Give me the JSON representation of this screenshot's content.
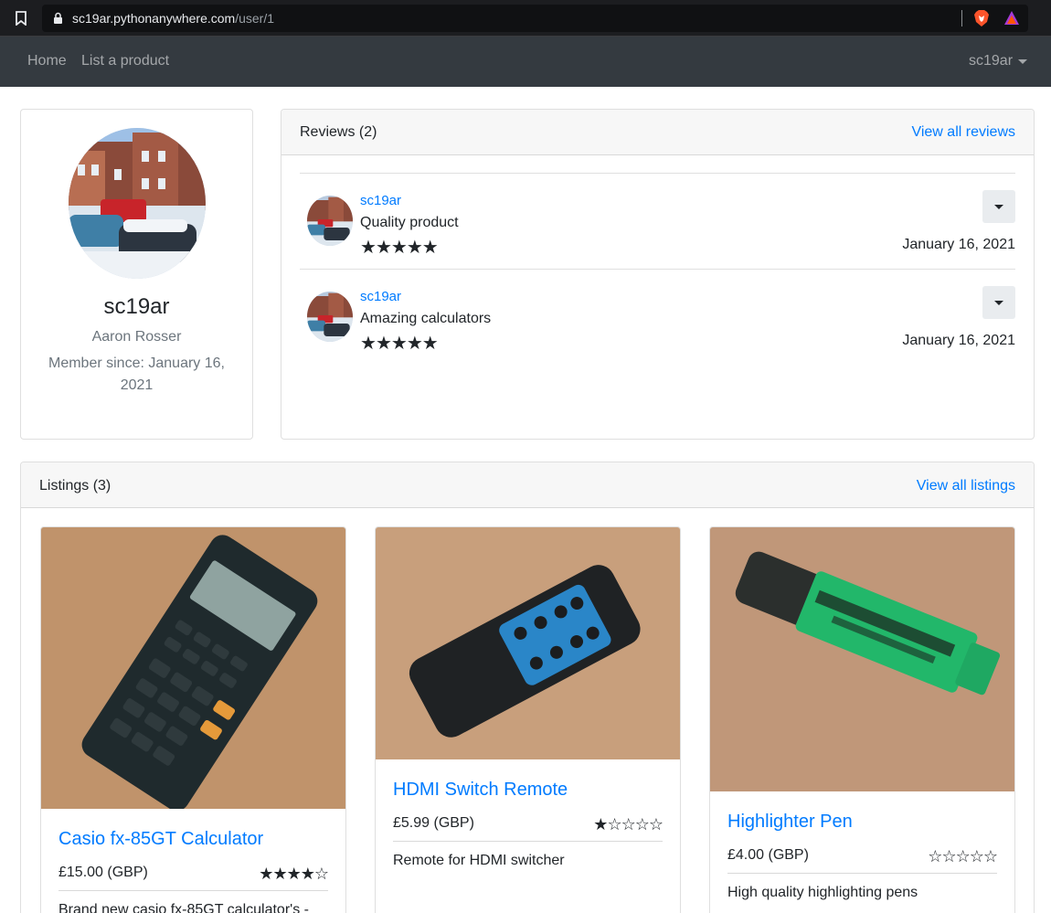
{
  "browser": {
    "url_host": "sc19ar.pythonanywhere.com",
    "url_path": "/user/1"
  },
  "navbar": {
    "home_label": "Home",
    "list_product_label": "List a product",
    "user_label": "sc19ar"
  },
  "profile": {
    "username": "sc19ar",
    "full_name": "Aaron Rosser",
    "member_since": "Member since: January 16, 2021"
  },
  "reviews": {
    "header_title": "Reviews (2)",
    "view_all_label": "View all reviews",
    "items": [
      {
        "author": "sc19ar",
        "text": "Quality product",
        "rating": 5,
        "date": "January 16, 2021"
      },
      {
        "author": "sc19ar",
        "text": "Amazing calculators",
        "rating": 5,
        "date": "January 16, 2021"
      }
    ]
  },
  "listings": {
    "header_title": "Listings (3)",
    "view_all_label": "View all listings",
    "items": [
      {
        "title": "Casio fx-85GT Calculator",
        "price": "£15.00 (GBP)",
        "rating": 4,
        "description": "Brand new casio fx-85GT calculator's -"
      },
      {
        "title": "HDMI Switch Remote",
        "price": "£5.99 (GBP)",
        "rating": 1,
        "description": "Remote for HDMI switcher"
      },
      {
        "title": "Highlighter Pen",
        "price": "£4.00 (GBP)",
        "rating": 0,
        "description": "High quality highlighting pens"
      }
    ]
  },
  "colors": {
    "navbar_bg": "#343a40",
    "link": "#007bff",
    "card_header_bg": "#f7f7f7"
  },
  "icons": [
    "bookmark-icon",
    "lock-icon",
    "brave-shield-icon",
    "brave-rewards-icon",
    "caret-down-icon",
    "star-icon"
  ]
}
